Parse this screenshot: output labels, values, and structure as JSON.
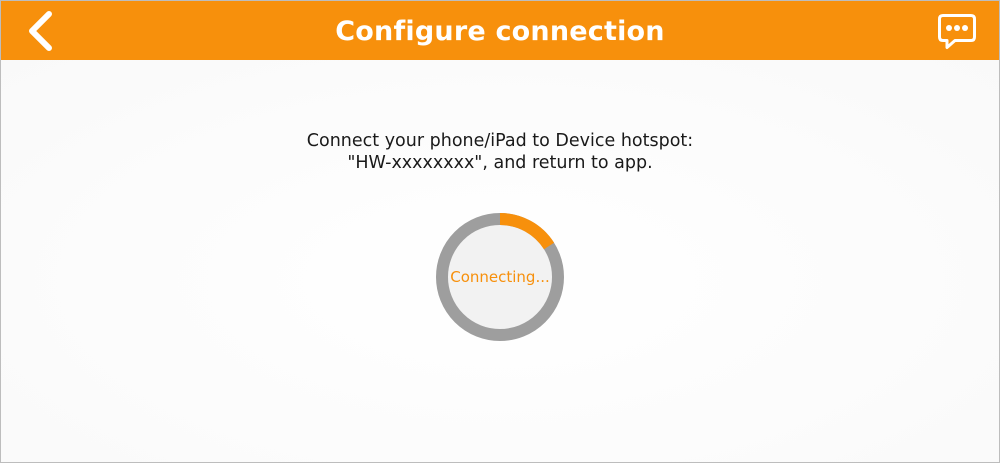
{
  "header": {
    "title": "Configure connection",
    "back_icon": "chevron-left-icon",
    "chat_icon": "chat-bubble-icon"
  },
  "instruction": {
    "line1": "Connect your phone/iPad to Device hotspot:",
    "line2": "\"HW-xxxxxxxx\", and return to app."
  },
  "status": {
    "label": "Connecting...",
    "progress": 0.16
  },
  "colors": {
    "accent": "#f7900c",
    "ring_track": "#9e9e9e",
    "ring_fill_inner": "#f2f2f2",
    "text": "#1a1a1a"
  }
}
